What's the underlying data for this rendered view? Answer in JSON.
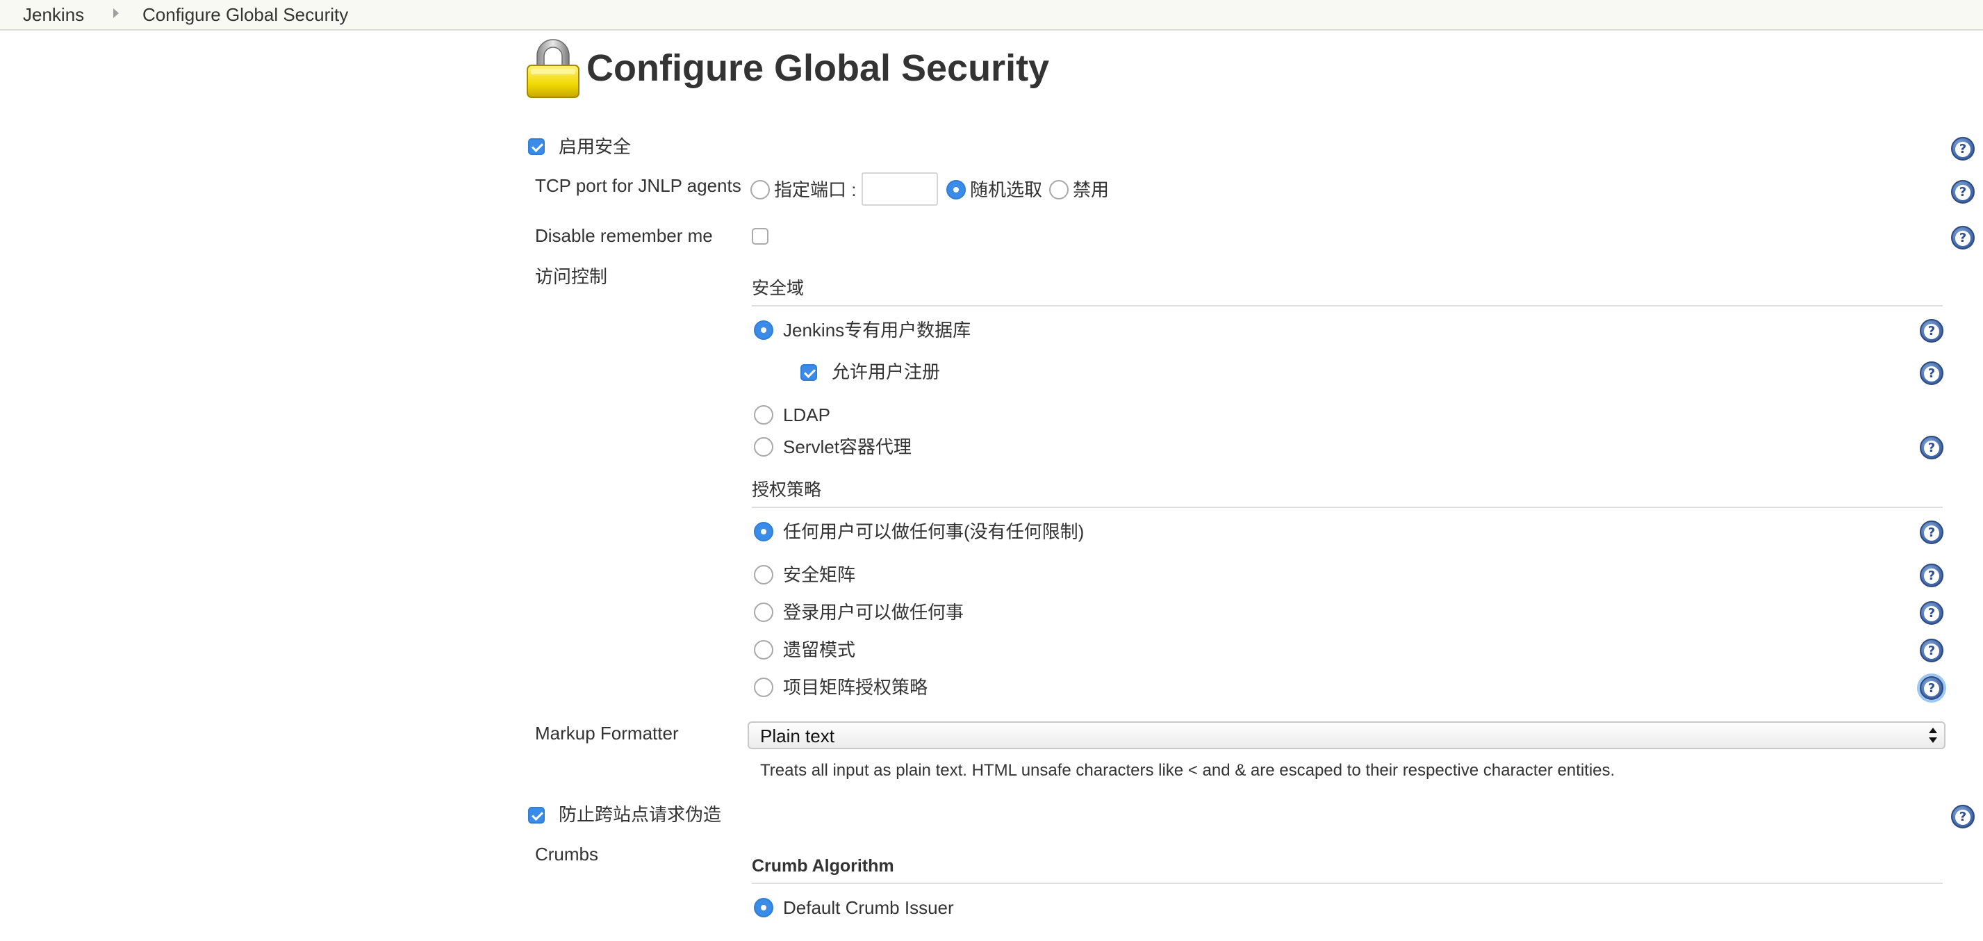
{
  "breadcrumb": {
    "items": [
      {
        "label": "Jenkins"
      },
      {
        "label": "Configure Global Security"
      }
    ]
  },
  "page": {
    "title": "Configure Global Security"
  },
  "enable_security": {
    "label": "启用安全",
    "checked": true
  },
  "tcp_port": {
    "label": "TCP port for JNLP agents",
    "options": [
      {
        "label": "指定端口 :",
        "selected": false
      },
      {
        "label": "随机选取",
        "selected": true
      },
      {
        "label": "禁用",
        "selected": false
      }
    ],
    "port_value": ""
  },
  "disable_remember_me": {
    "label": "Disable remember me",
    "checked": false
  },
  "access_control": {
    "label": "访问控制",
    "security_realm": {
      "title": "安全域",
      "options": [
        {
          "label": "Jenkins专有用户数据库",
          "selected": true
        },
        {
          "label": "LDAP",
          "selected": false
        },
        {
          "label": "Servlet容器代理",
          "selected": false
        }
      ],
      "allow_signup": {
        "label": "允许用户注册",
        "checked": true
      }
    },
    "authorization": {
      "title": "授权策略",
      "options": [
        {
          "label": "任何用户可以做任何事(没有任何限制)",
          "selected": true
        },
        {
          "label": "安全矩阵",
          "selected": false
        },
        {
          "label": "登录用户可以做任何事",
          "selected": false
        },
        {
          "label": "遗留模式",
          "selected": false
        },
        {
          "label": "项目矩阵授权策略",
          "selected": false
        }
      ]
    }
  },
  "markup_formatter": {
    "label": "Markup Formatter",
    "selected": "Plain text",
    "description": "Treats all input as plain text. HTML unsafe characters like < and & are escaped to their respective character entities."
  },
  "csrf": {
    "label": "防止跨站点请求伪造",
    "checked": true
  },
  "crumbs": {
    "label": "Crumbs",
    "algorithm_title": "Crumb Algorithm",
    "options": [
      {
        "label": "Default Crumb Issuer",
        "selected": true
      }
    ]
  },
  "icons": {
    "lock": "lock-icon",
    "help": "help-icon",
    "breadcrumb_separator": "triangle-right-icon"
  },
  "colors": {
    "accent": "#3b8ce8",
    "help_icon": "#4a72b3",
    "breadcrumb_bg": "#f9f9f4"
  }
}
